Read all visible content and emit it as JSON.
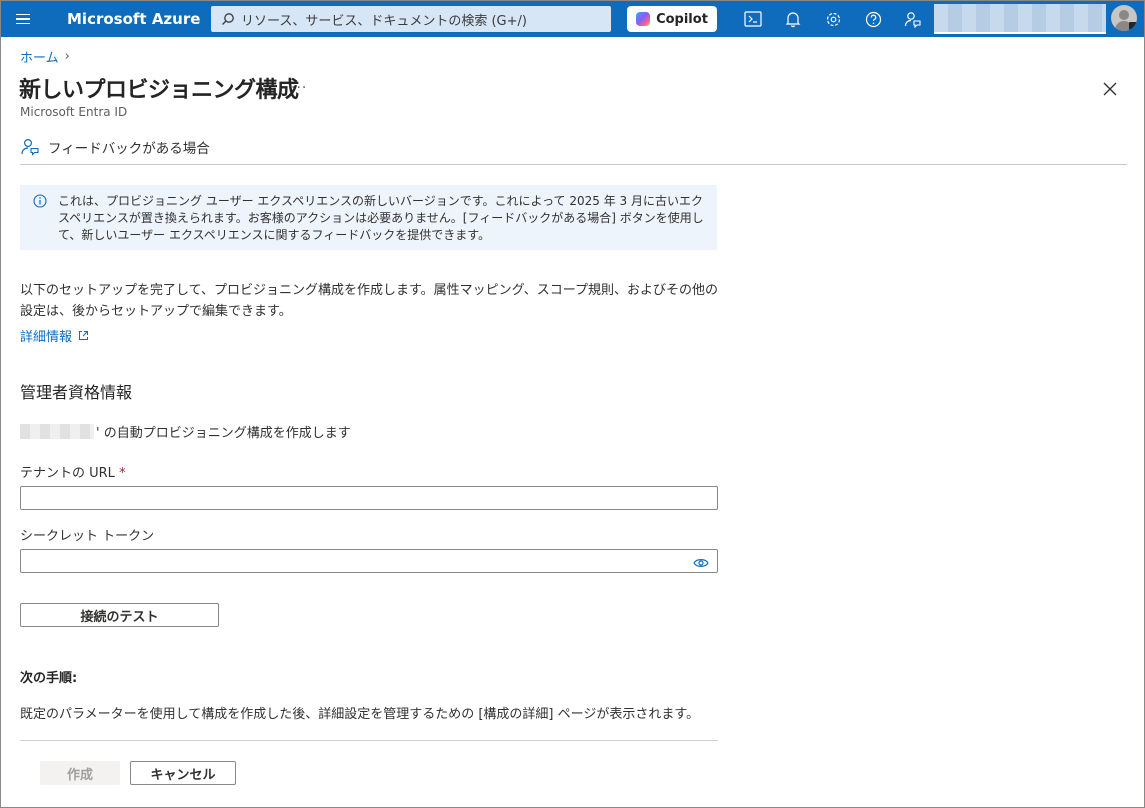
{
  "topbar": {
    "brand": "Microsoft Azure",
    "search_placeholder": "リソース、サービス、ドキュメントの検索 (G+/)",
    "copilot_label": "Copilot",
    "icons": [
      "cloud-shell-icon",
      "bell-icon",
      "gear-icon",
      "help-icon",
      "feedback-icon"
    ]
  },
  "breadcrumb": {
    "home": "ホーム"
  },
  "header": {
    "title": "新しいプロビジョニング構成",
    "more": "···",
    "subtitle": "Microsoft Entra ID"
  },
  "command_bar": {
    "feedback": "フィードバックがある場合"
  },
  "info_banner": {
    "text": "これは、プロビジョニング ユーザー エクスペリエンスの新しいバージョンです。これによって 2025 年 3 月に古いエクスペリエンスが置き換えられます。お客様のアクションは必要ありません。[フィードバックがある場合] ボタンを使用して、新しいユーザー エクスペリエンスに関するフィードバックを提供できます。"
  },
  "description": "以下のセットアップを完了して、プロビジョニング構成を作成します。属性マッピング、スコープ規則、およびその他の設定は、後からセットアップで編集できます。",
  "learn_more": "詳細情報",
  "credentials": {
    "section_title": "管理者資格情報",
    "auto_text": "' の自動プロビジョニング構成を作成します",
    "tenant_url_label": "テナントの URL",
    "required_mark": " *",
    "tenant_url_value": "",
    "secret_token_label": "シークレット トークン",
    "secret_token_value": "",
    "test_button": "接続のテスト"
  },
  "next_steps": {
    "title": "次の手順:",
    "text": "既定のパラメーターを使用して構成を作成した後、詳細設定を管理するための [構成の詳細] ページが表示されます。"
  },
  "footer": {
    "create": "作成",
    "cancel": "キャンセル"
  },
  "colors": {
    "accent": "#0f6cbd",
    "banner": "#eef4fb"
  }
}
